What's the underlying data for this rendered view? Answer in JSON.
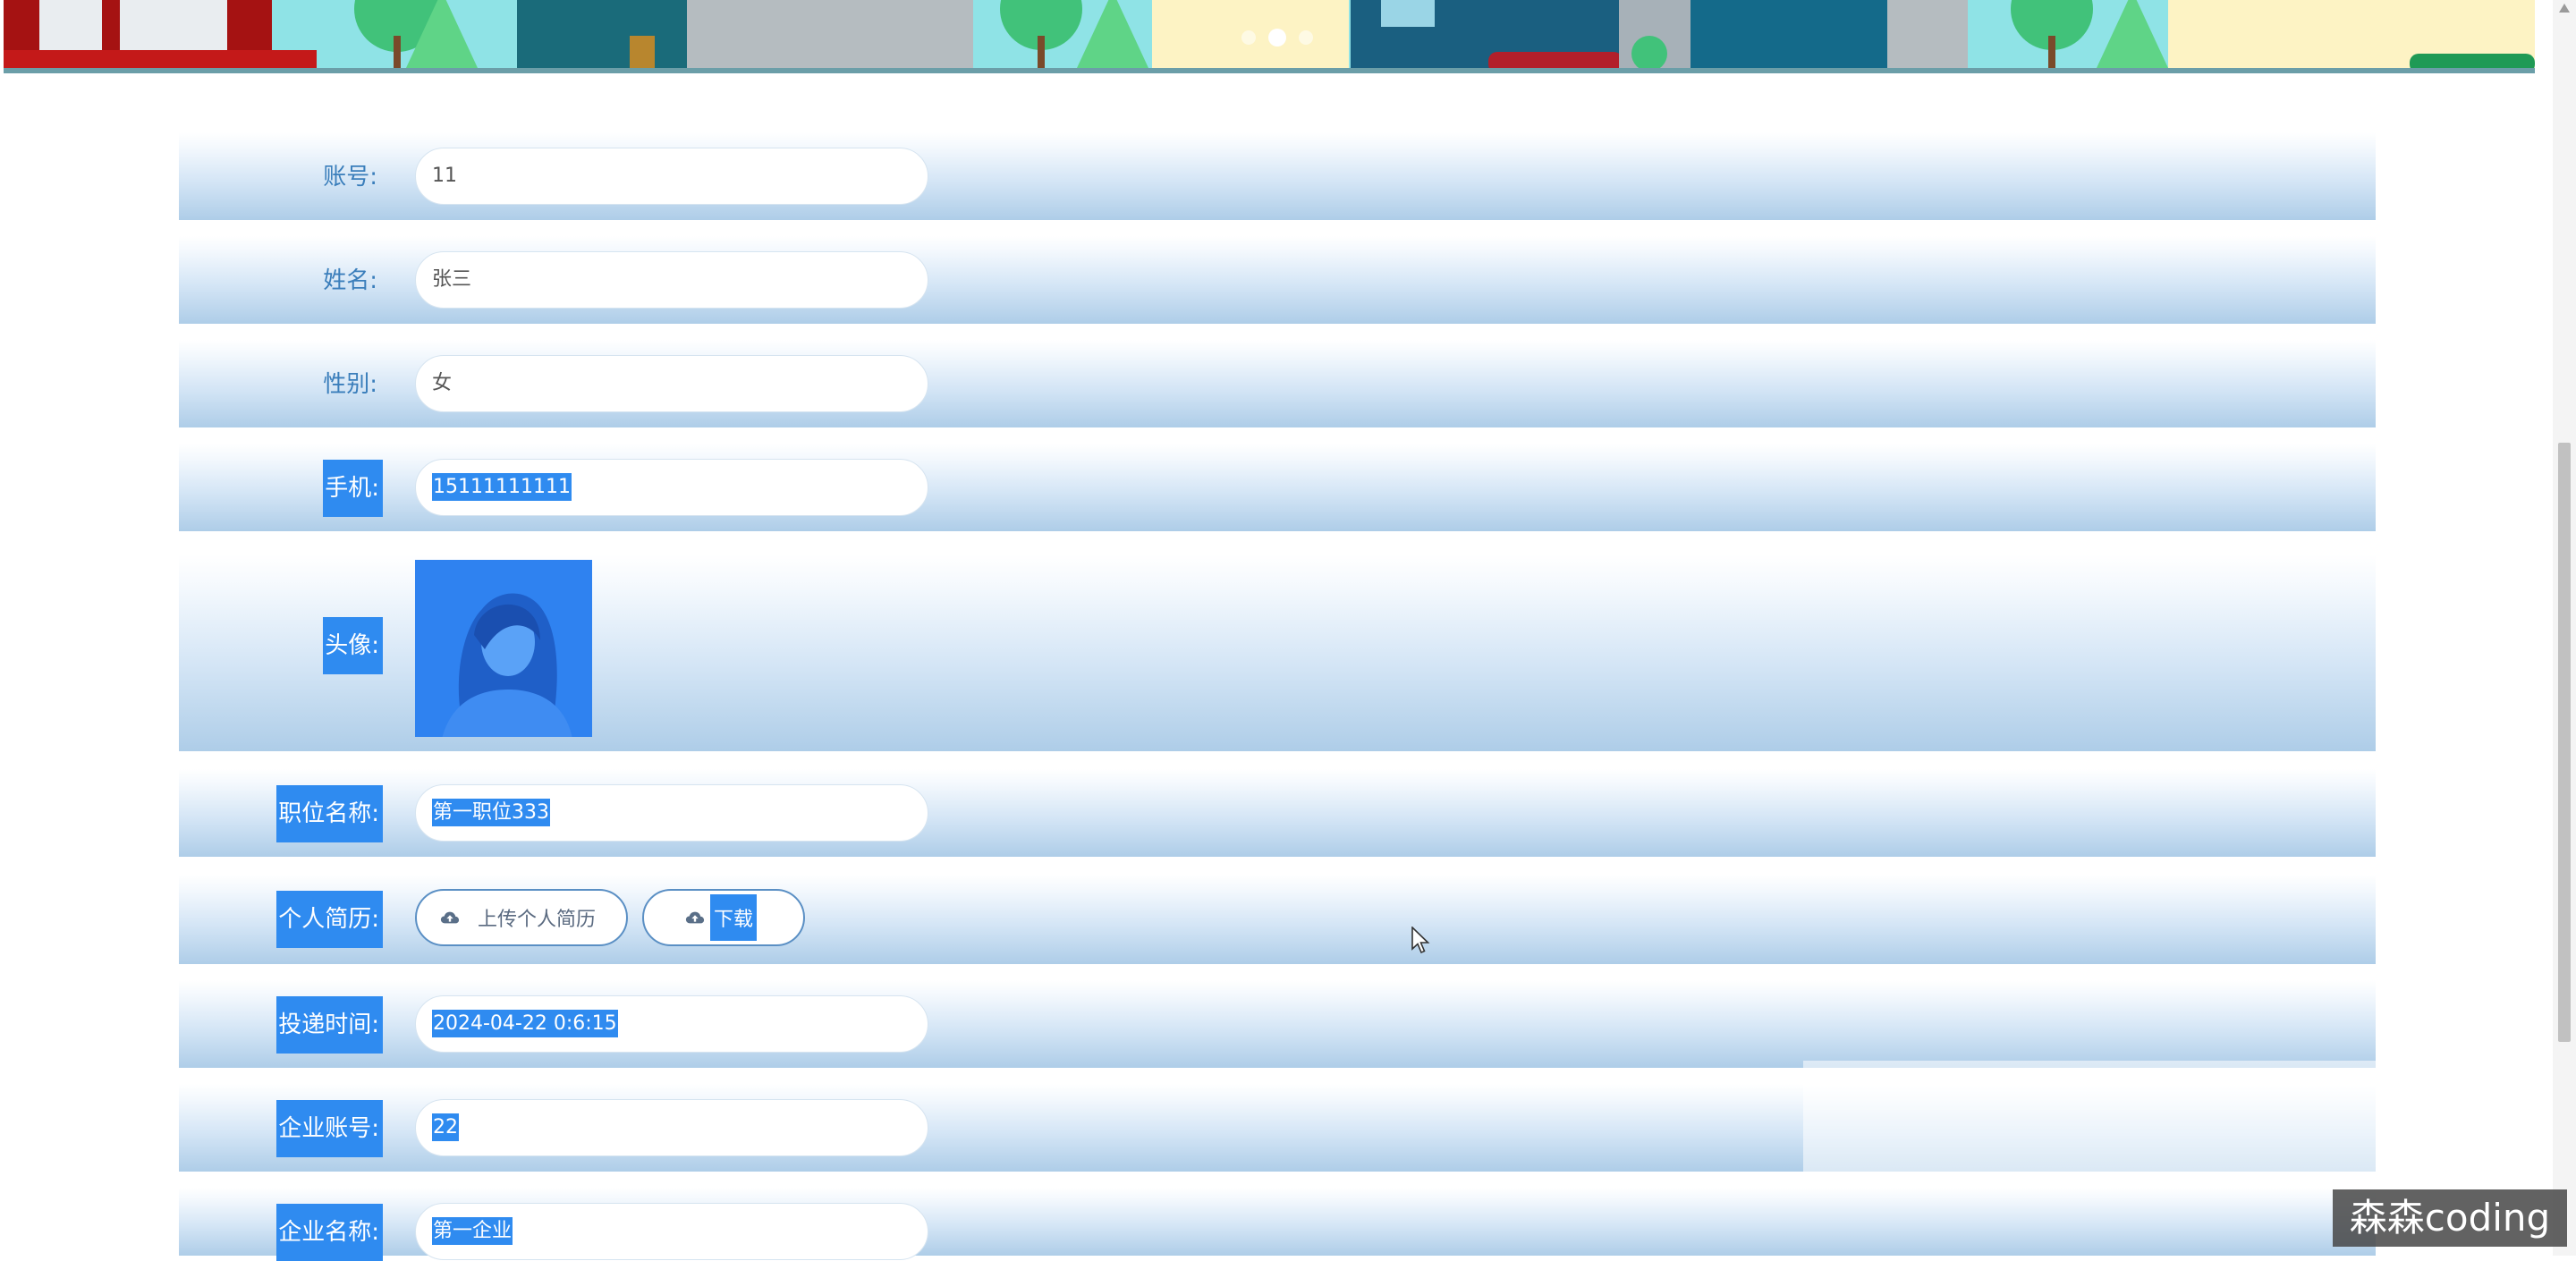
{
  "banner": {
    "slides": 3,
    "active_slide": 2
  },
  "form": {
    "account": {
      "label": "账号:",
      "value": "11"
    },
    "name": {
      "label": "姓名:",
      "value": "张三"
    },
    "gender": {
      "label": "性别:",
      "value": "女"
    },
    "phone": {
      "label": "手机:",
      "value": "15111111111"
    },
    "avatar": {
      "label": "头像:"
    },
    "position_name": {
      "label": "职位名称:",
      "value": "第一职位333"
    },
    "resume": {
      "label": "个人简历:",
      "upload_label": "上传个人简历",
      "download_label": "下载"
    },
    "submit_time": {
      "label": "投递时间:",
      "value": "2024-04-22 0:6:15"
    },
    "company_account": {
      "label": "企业账号:",
      "value": "22"
    },
    "company_name": {
      "label": "企业名称:",
      "value": "第一企业"
    }
  },
  "watermark": "森森coding",
  "colors": {
    "label": "#3a7ebb",
    "selection": "#2f8bf0",
    "row_gradient_end": "#aecde8",
    "button_border": "#5a8fc4"
  }
}
